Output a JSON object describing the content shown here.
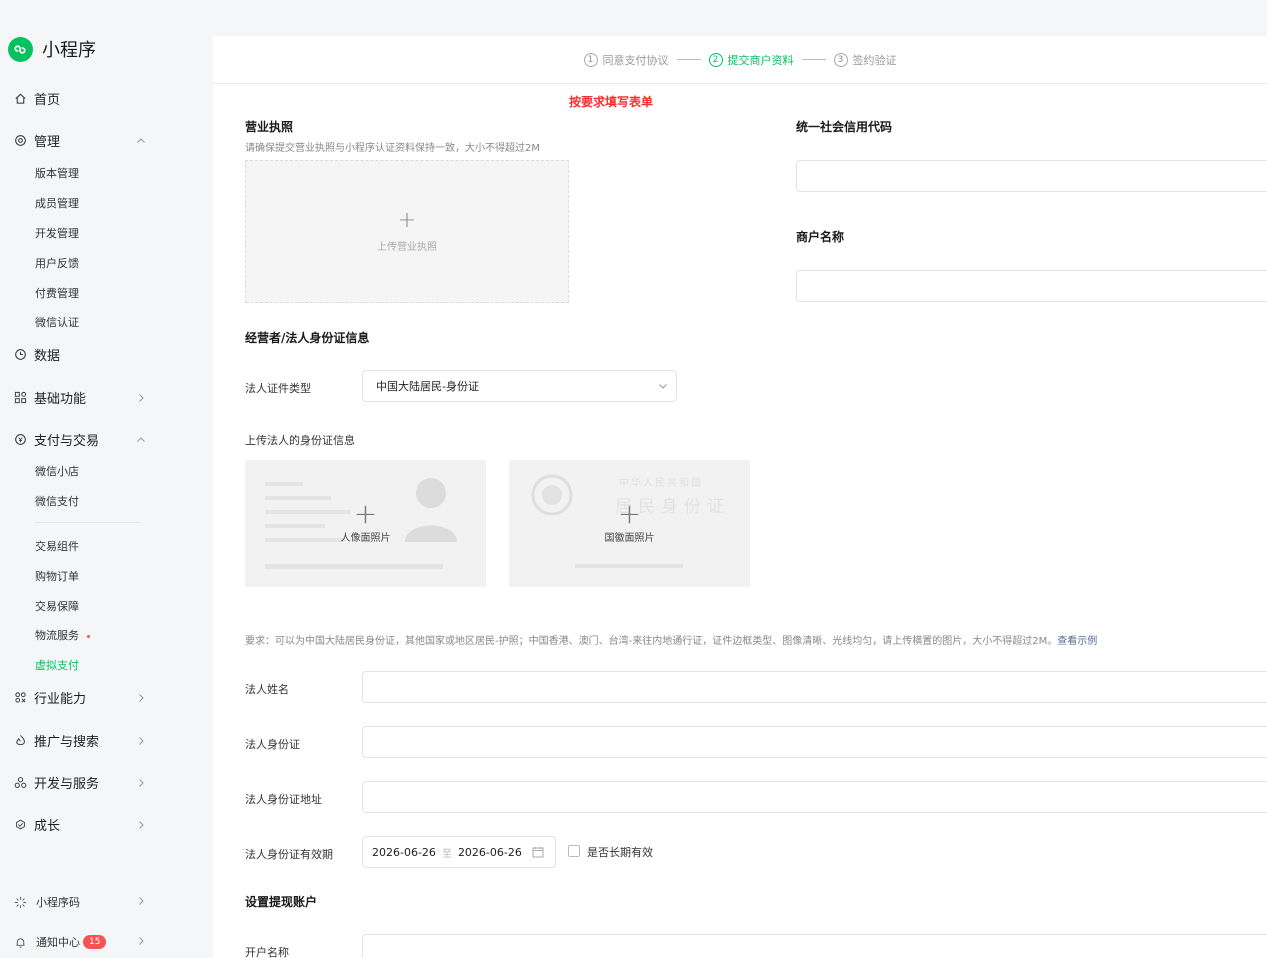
{
  "sidebar": {
    "brand": "小程序",
    "home": "首页",
    "manage": {
      "label": "管理",
      "items": [
        "版本管理",
        "成员管理",
        "开发管理",
        "用户反馈",
        "付费管理",
        "微信认证"
      ]
    },
    "data": "数据",
    "basic": "基础功能",
    "pay": {
      "label": "支付与交易",
      "items_top": [
        "微信小店",
        "微信支付"
      ],
      "items_bottom": [
        "交易组件",
        "购物订单",
        "交易保障",
        "物流服务",
        "虚拟支付"
      ]
    },
    "industry": "行业能力",
    "promo": "推广与搜索",
    "devservice": "开发与服务",
    "growth": "成长",
    "qrcode": "小程序码",
    "notify": "通知中心",
    "notify_count": "15"
  },
  "steps": [
    {
      "num": "1",
      "label": "同意支付协议"
    },
    {
      "num": "2",
      "label": "提交商户资料"
    },
    {
      "num": "3",
      "label": "签约验证"
    }
  ],
  "form": {
    "notice": "按要求填写表单",
    "license_title": "营业执照",
    "license_hint": "请确保提交营业执照与小程序认证资料保持一致，大小不得超过2M",
    "license_upload": "上传营业执照",
    "credit_code_label": "统一社会信用代码",
    "merchant_name_label": "商户名称",
    "legal_section": "经营者/法人身份证信息",
    "id_type_label": "法人证件类型",
    "id_type_value": "中国大陆居民-身份证",
    "upload_id_label": "上传法人的身份证信息",
    "portrait_label": "人像面照片",
    "emblem_label": "国徽面照片",
    "emblem_bg_line1": "中华人民共和国",
    "emblem_bg_line2": "居民身份证",
    "requirement_text": "要求：可以为中国大陆居民身份证，其他国家或地区居民-护照；中国香港、澳门、台湾-来往内地通行证，证件边框类型、图像清晰、光线均匀，请上传横置的图片，大小不得超过2M。",
    "requirement_link": "查看示例",
    "legal_name_label": "法人姓名",
    "legal_id_label": "法人身份证",
    "legal_address_label": "法人身份证地址",
    "legal_validity_label": "法人身份证有效期",
    "date_start": "2026-06-26",
    "date_sep": "至",
    "date_end": "2026-06-26",
    "long_term_label": "是否长期有效",
    "withdraw_section": "设置提现账户",
    "account_name_label": "开户名称"
  }
}
